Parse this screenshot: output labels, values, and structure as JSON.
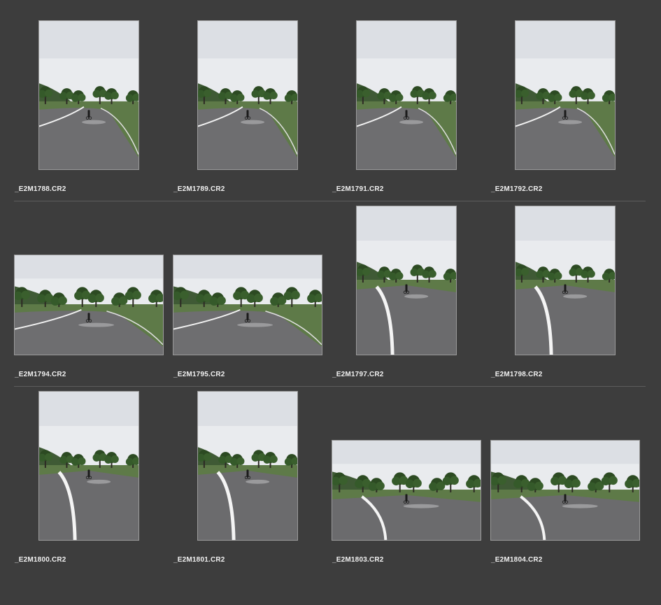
{
  "grid": {
    "rows": [
      {
        "items": [
          {
            "filename": "_E2M1788.CR2",
            "orientation": "portrait",
            "lane": "curve"
          },
          {
            "filename": "_E2M1789.CR2",
            "orientation": "portrait",
            "lane": "curve"
          },
          {
            "filename": "_E2M1791.CR2",
            "orientation": "portrait",
            "lane": "curve"
          },
          {
            "filename": "_E2M1792.CR2",
            "orientation": "portrait",
            "lane": "curve"
          }
        ]
      },
      {
        "items": [
          {
            "filename": "_E2M1794.CR2",
            "orientation": "landscape",
            "lane": "curve"
          },
          {
            "filename": "_E2M1795.CR2",
            "orientation": "landscape",
            "lane": "curve"
          },
          {
            "filename": "_E2M1797.CR2",
            "orientation": "portrait",
            "lane": "center"
          },
          {
            "filename": "_E2M1798.CR2",
            "orientation": "portrait",
            "lane": "center"
          }
        ]
      },
      {
        "items": [
          {
            "filename": "_E2M1800.CR2",
            "orientation": "portrait",
            "lane": "center"
          },
          {
            "filename": "_E2M1801.CR2",
            "orientation": "portrait",
            "lane": "center"
          },
          {
            "filename": "_E2M1803.CR2",
            "orientation": "landscape",
            "lane": "center"
          },
          {
            "filename": "_E2M1804.CR2",
            "orientation": "landscape",
            "lane": "center"
          }
        ]
      }
    ]
  },
  "colors": {
    "background": "#3d3d3d",
    "separator": "#5c5c5c",
    "thumb_border": "#9a9a9a",
    "filename_text": "#f0f0f0"
  }
}
